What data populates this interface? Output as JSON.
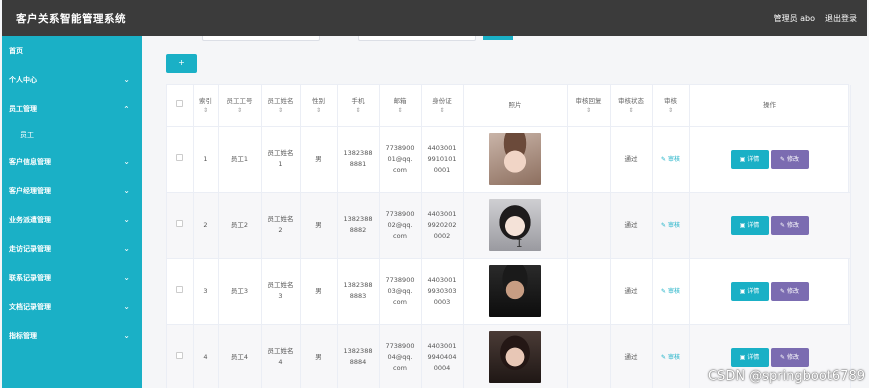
{
  "app_title": "客户关系智能管理系统",
  "header": {
    "user_label": "管理员 abo",
    "logout_label": "退出登录"
  },
  "sidebar": {
    "items": [
      {
        "label": "首页",
        "has_chevron": false
      },
      {
        "label": "个人中心",
        "has_chevron": true
      },
      {
        "label": "员工管理",
        "has_chevron": true,
        "expanded": true
      },
      {
        "label": "员工",
        "sub": true
      },
      {
        "label": "客户信息管理",
        "has_chevron": true
      },
      {
        "label": "客户经理管理",
        "has_chevron": true
      },
      {
        "label": "业务派遣管理",
        "has_chevron": true
      },
      {
        "label": "走访记录管理",
        "has_chevron": true
      },
      {
        "label": "联系记录管理",
        "has_chevron": true
      },
      {
        "label": "文档记录管理",
        "has_chevron": true
      },
      {
        "label": "指标管理",
        "has_chevron": true
      }
    ]
  },
  "toolbar": {
    "add_label": "+"
  },
  "table": {
    "headers": [
      "索引",
      "员工工号",
      "员工姓名",
      "性别",
      "手机",
      "邮箱",
      "身份证",
      "照片",
      "审核回复",
      "审核状态",
      "审核",
      "操作"
    ],
    "rows": [
      {
        "index": "1",
        "emp_no": "员工1",
        "name": "员工姓名\n1",
        "gender": "男",
        "phone": "1382388\n8881",
        "email": "7738900\n01@qq.\ncom",
        "id_card": "4403001\n9910101\n0001",
        "reply": "",
        "status": "通过",
        "audit": "审核"
      },
      {
        "index": "2",
        "emp_no": "员工2",
        "name": "员工姓名\n2",
        "gender": "男",
        "phone": "1382388\n8882",
        "email": "7738900\n02@qq.\ncom",
        "id_card": "4403001\n9920202\n0002",
        "reply": "",
        "status": "通过",
        "audit": "审核"
      },
      {
        "index": "3",
        "emp_no": "员工3",
        "name": "员工姓名\n3",
        "gender": "男",
        "phone": "1382388\n8883",
        "email": "7738900\n03@qq.\ncom",
        "id_card": "4403001\n9930303\n0003",
        "reply": "",
        "status": "通过",
        "audit": "审核"
      },
      {
        "index": "4",
        "emp_no": "员工4",
        "name": "员工姓名\n4",
        "gender": "男",
        "phone": "1382388\n8884",
        "email": "7738900\n04@qq.\ncom",
        "id_card": "4403001\n9940404\n0004",
        "reply": "",
        "status": "通过",
        "audit": "审核"
      }
    ],
    "detail_label": "详情",
    "edit_label": "修改"
  },
  "watermark": "CSDN @springboot6789",
  "colors": {
    "accent": "#1ab0c6",
    "topbar": "#3b3b3b",
    "edit": "#7b6cb1"
  }
}
